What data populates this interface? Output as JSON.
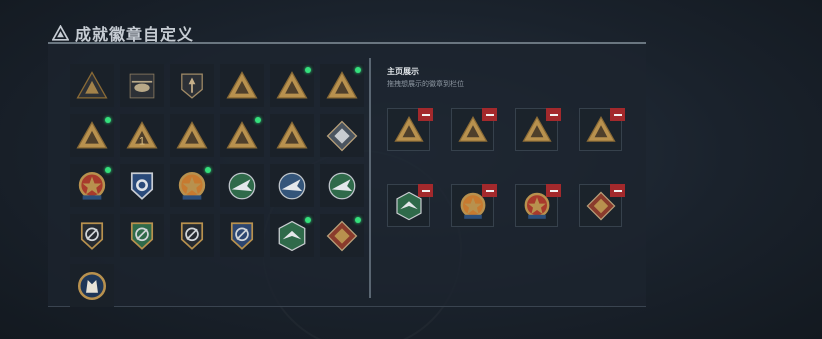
{
  "header": {
    "title": "成就徽章自定义",
    "icon": "warning-triangle-icon"
  },
  "showcase": {
    "title": "主页展示",
    "subtitle": "拖拽想展示的徽章到栏位"
  },
  "colors": {
    "gold": "#b8914e",
    "green": "#2f6a4a",
    "red_remove": "#a3292c",
    "new_dot": "#35e07c"
  },
  "badges": [
    {
      "kind": "triangle-dark-badge-icon",
      "new": false
    },
    {
      "kind": "helicopter-badge-icon",
      "new": false
    },
    {
      "kind": "shield-arrow-badge-icon",
      "new": false
    },
    {
      "kind": "triangle-fire-badge-icon",
      "new": false
    },
    {
      "kind": "triangle-gold-badge-icon",
      "new": true
    },
    {
      "kind": "triangle-helmet-badge-icon",
      "new": true
    },
    {
      "kind": "triangle-soldier-badge-icon",
      "new": true
    },
    {
      "kind": "triangle-number-one-badge-icon",
      "new": false
    },
    {
      "kind": "triangle-bottle-badge-icon",
      "new": false
    },
    {
      "kind": "triangle-runner-badge-icon",
      "new": true
    },
    {
      "kind": "triangle-tank-badge-icon",
      "new": false
    },
    {
      "kind": "diamond-rifle-badge-icon",
      "new": false
    },
    {
      "kind": "medal-star-badge-icon",
      "new": true
    },
    {
      "kind": "shield-blue-badge-icon",
      "new": false
    },
    {
      "kind": "medal-orange-badge-icon",
      "new": true
    },
    {
      "kind": "green-plane-badge-icon",
      "new": false
    },
    {
      "kind": "blue-jet-badge-icon",
      "new": false
    },
    {
      "kind": "green-jet-badge-icon",
      "new": false
    },
    {
      "kind": "shield-outline-badge-icon",
      "new": false
    },
    {
      "kind": "shield-green-badge-icon",
      "new": false
    },
    {
      "kind": "shield-dark-badge-icon",
      "new": false
    },
    {
      "kind": "shield-wings-badge-icon",
      "new": false
    },
    {
      "kind": "hex-green-eagle-badge-icon",
      "new": true
    },
    {
      "kind": "diamond-red-badge-icon",
      "new": true
    },
    {
      "kind": "round-wolf-badge-icon",
      "new": false
    }
  ],
  "slots": [
    {
      "kind": "triangle-gold-badge-icon"
    },
    {
      "kind": "triangle-soldier-badge-icon"
    },
    {
      "kind": "triangle-runner-badge-icon"
    },
    {
      "kind": "triangle-helmet-badge-icon"
    },
    {
      "kind": "hex-green-eagle-badge-icon"
    },
    {
      "kind": "medal-orange-badge-icon"
    },
    {
      "kind": "medal-star-badge-icon"
    },
    {
      "kind": "diamond-red-badge-icon"
    }
  ]
}
